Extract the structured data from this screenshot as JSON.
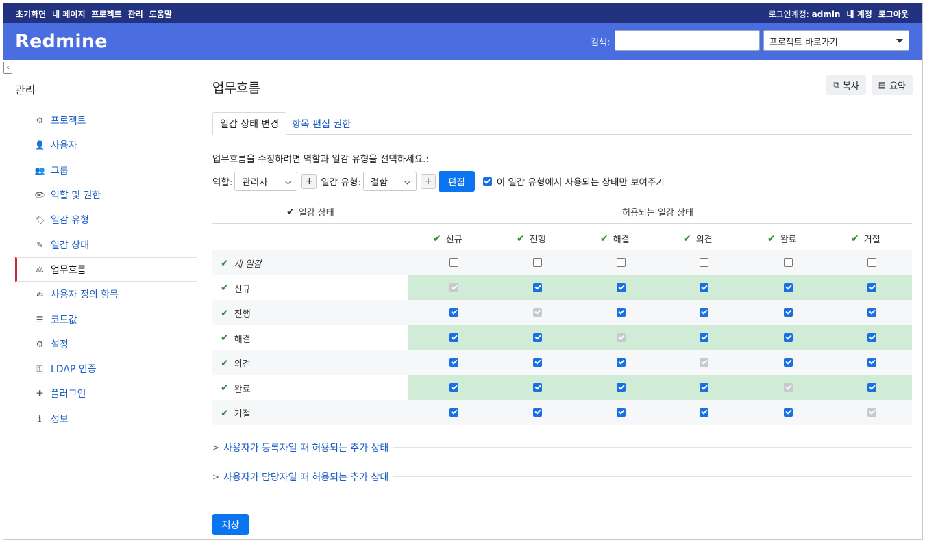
{
  "topmenu": {
    "left": [
      "초기화면",
      "내 페이지",
      "프로젝트",
      "관리",
      "도움말"
    ],
    "logged_in_label": "로그인계정:",
    "user": "admin",
    "my_account": "내 계정",
    "logout": "로그아웃"
  },
  "header": {
    "brand": "Redmine",
    "search_label": "검색:",
    "search_value": "",
    "jump_label": "프로젝트 바로가기"
  },
  "sidebar": {
    "title": "관리",
    "items": [
      {
        "label": "프로젝트",
        "icon": "projects-icon",
        "glyph": "⚙"
      },
      {
        "label": "사용자",
        "icon": "user-icon",
        "glyph": "👤"
      },
      {
        "label": "그룹",
        "icon": "group-icon",
        "glyph": "👥"
      },
      {
        "label": "역할 및 권한",
        "icon": "eye-icon",
        "glyph": "👁"
      },
      {
        "label": "일감 유형",
        "icon": "tag-icon",
        "glyph": "🏷"
      },
      {
        "label": "일감 상태",
        "icon": "edit-square-icon",
        "glyph": "✎"
      },
      {
        "label": "업무흐름",
        "icon": "workflow-icon",
        "glyph": "⚖",
        "active": true
      },
      {
        "label": "사용자 정의 항목",
        "icon": "custom-fields-icon",
        "glyph": "✍"
      },
      {
        "label": "코드값",
        "icon": "list-icon",
        "glyph": "☰"
      },
      {
        "label": "설정",
        "icon": "gear-icon",
        "glyph": "⚙"
      },
      {
        "label": "LDAP 인증",
        "icon": "key-icon",
        "glyph": "⚿"
      },
      {
        "label": "플러그인",
        "icon": "plugin-icon",
        "glyph": "✚"
      },
      {
        "label": "정보",
        "icon": "info-icon",
        "glyph": "ℹ"
      }
    ]
  },
  "main": {
    "title": "업무흐름",
    "copy_label": "복사",
    "summary_label": "요약",
    "tabs": [
      "일감 상태 변경",
      "항목 편집 권한"
    ],
    "instructions": "업무흐름을 수정하려면 역할과 일감 유형을 선택하세요.:",
    "role_label": "역할:",
    "role_value": "관리자",
    "tracker_label": "일감 유형:",
    "tracker_value": "결함",
    "edit_label": "편집",
    "only_used_label": "이 일감 유형에서 사용되는 상태만 보여주기",
    "col_status": "일감 상태",
    "col_allowed": "허용되는 일감 상태",
    "columns": [
      "신규",
      "진행",
      "해결",
      "의견",
      "완료",
      "거절"
    ],
    "rows": [
      {
        "label": "새 일감",
        "italic": true,
        "cells": [
          "empty",
          "empty",
          "empty",
          "empty",
          "empty",
          "empty"
        ]
      },
      {
        "label": "신규",
        "cells": [
          "gray",
          "blue",
          "blue",
          "blue",
          "blue",
          "blue"
        ]
      },
      {
        "label": "진행",
        "cells": [
          "blue",
          "gray",
          "blue",
          "blue",
          "blue",
          "blue"
        ]
      },
      {
        "label": "해결",
        "cells": [
          "blue",
          "blue",
          "gray",
          "blue",
          "blue",
          "blue"
        ]
      },
      {
        "label": "의견",
        "cells": [
          "blue",
          "blue",
          "blue",
          "gray",
          "blue",
          "blue"
        ]
      },
      {
        "label": "완료",
        "cells": [
          "blue",
          "blue",
          "blue",
          "blue",
          "gray",
          "blue"
        ]
      },
      {
        "label": "거절",
        "cells": [
          "blue",
          "blue",
          "blue",
          "blue",
          "blue",
          "gray"
        ]
      }
    ],
    "author_section": "사용자가 등록자일 때 허용되는 추가 상태",
    "assignee_section": "사용자가 담당자일 때 허용되는 추가 상태",
    "save_label": "저장"
  },
  "colors": {
    "topmenu": "#22327f",
    "header": "#4a6de0",
    "link": "#1c5fc4",
    "primary": "#0b74f0",
    "highlight_row": "#d0ecd7",
    "active_marker": "#cc2733"
  }
}
